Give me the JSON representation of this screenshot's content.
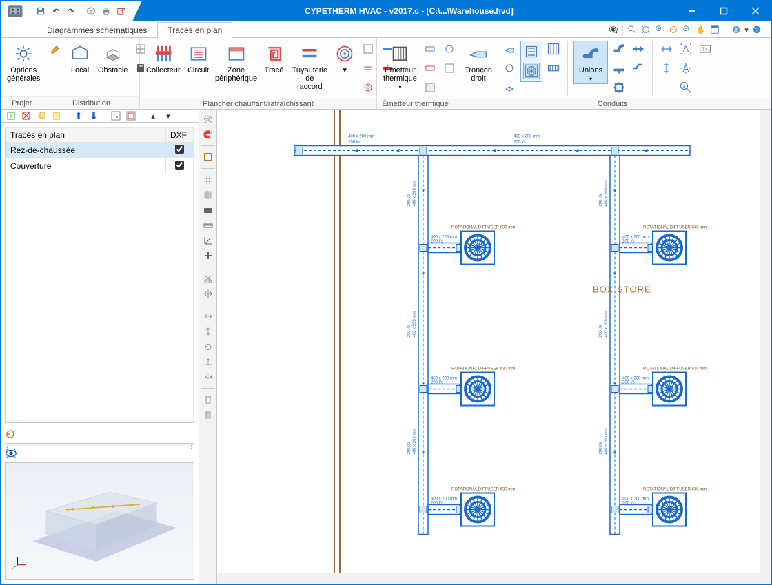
{
  "title": "CYPETHERM HVAC - v2017.c - [C:\\...\\Warehouse.hvd]",
  "tabs": {
    "t0": "Diagrammes schématiques",
    "t1": "Tracés en plan"
  },
  "ribbon": {
    "projet": {
      "caption": "Projet",
      "options": "Options\ngénérales"
    },
    "distribution": {
      "caption": "Distribution",
      "local": "Local",
      "obstacle": "Obstacle"
    },
    "plancher": {
      "caption": "Plancher chauffant/rafraîchissant",
      "collecteur": "Collecteur",
      "circuit": "Circuit",
      "zone": "Zone\npériphérique",
      "trace": "Tracé",
      "tuyauterie": "Tuyauterie\nde raccord"
    },
    "emetteur_grp": {
      "caption": "Émetteur thermique",
      "emetteur": "Émetteur\nthermique"
    },
    "conduits": {
      "caption": "Conduits",
      "troncon": "Tronçon\ndroit",
      "unions": "Unions"
    }
  },
  "tree": {
    "col0": "Tracés en plan",
    "col1": "DXF",
    "r0": "Rez-de-chaussée",
    "r1": "Couverture"
  },
  "plan": {
    "room": "BOX STORE",
    "dim1": "400 x 200 mm",
    "dim2": "200 l/s",
    "dim_v": "400 x 200 mm",
    "diffuser": "ROTATIONAL DIFFUSER 630 mm"
  }
}
